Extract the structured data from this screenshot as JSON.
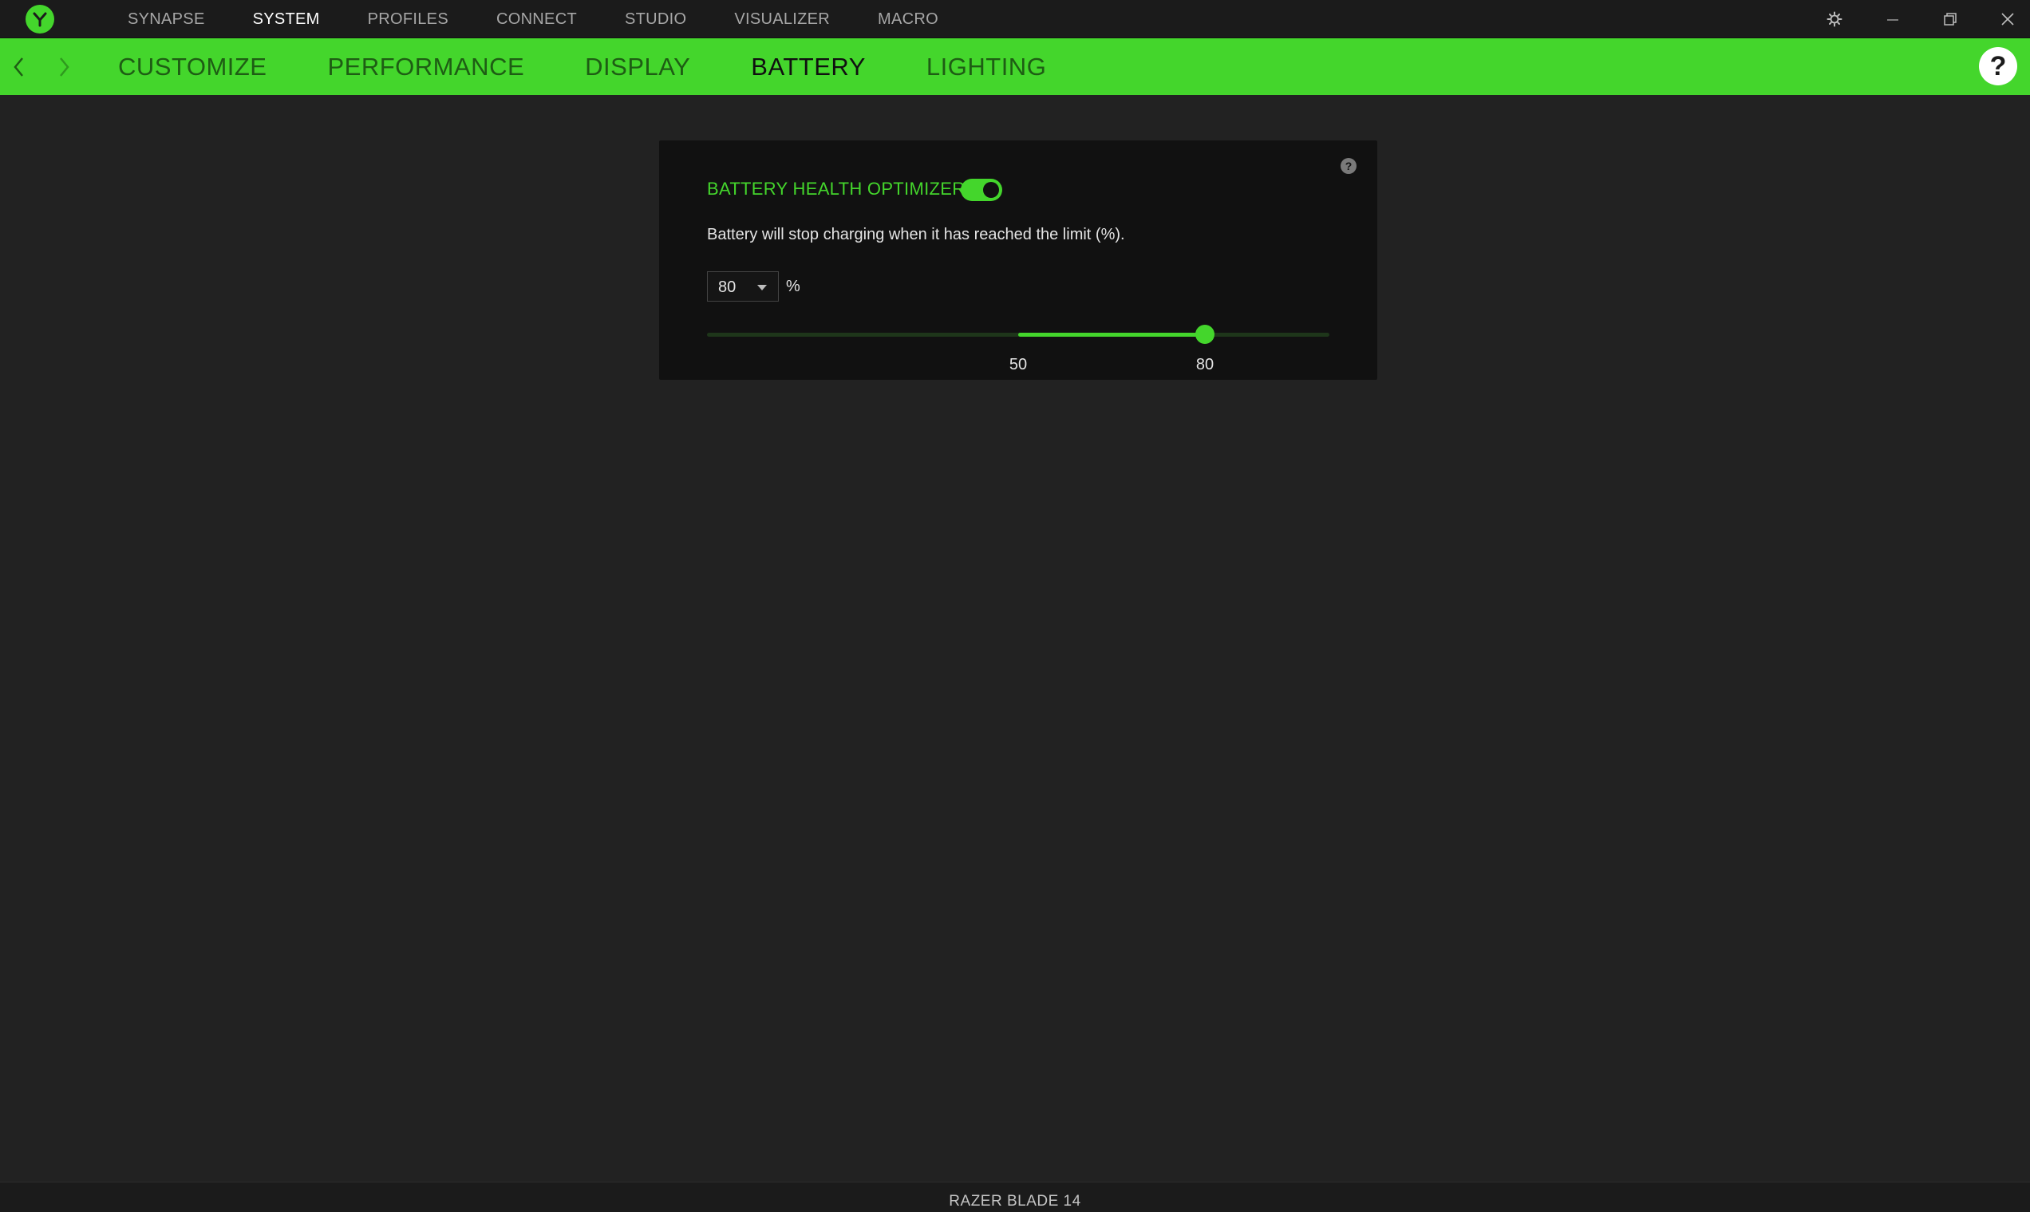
{
  "app": {
    "logo_icon": "razer-logo-icon",
    "accent_color": "#44d62c"
  },
  "top_nav": {
    "items": [
      {
        "label": "SYNAPSE",
        "active": false
      },
      {
        "label": "SYSTEM",
        "active": true
      },
      {
        "label": "PROFILES",
        "active": false
      },
      {
        "label": "CONNECT",
        "active": false
      },
      {
        "label": "STUDIO",
        "active": false
      },
      {
        "label": "VISUALIZER",
        "active": false
      },
      {
        "label": "MACRO",
        "active": false
      }
    ],
    "window_controls": [
      "gear-icon",
      "minimize-icon",
      "restore-icon",
      "close-icon"
    ]
  },
  "sub_nav": {
    "items": [
      {
        "label": "CUSTOMIZE",
        "active": false
      },
      {
        "label": "PERFORMANCE",
        "active": false
      },
      {
        "label": "DISPLAY",
        "active": false
      },
      {
        "label": "BATTERY",
        "active": true
      },
      {
        "label": "LIGHTING",
        "active": false
      }
    ],
    "help_label": "?"
  },
  "battery": {
    "title": "BATTERY HEALTH OPTIMIZER",
    "enabled": true,
    "description": "Battery will stop charging when it has reached the limit (%).",
    "limit_value": "80",
    "unit": "%",
    "slider": {
      "min": 0,
      "max": 100,
      "range_low": 50,
      "range_high": 80,
      "low_label": "50",
      "high_label": "80"
    },
    "help_label": "?"
  },
  "footer": {
    "device_name": "RAZER BLADE 14"
  }
}
